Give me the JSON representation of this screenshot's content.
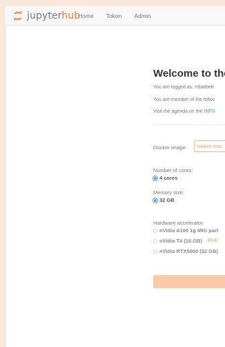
{
  "header": {
    "logo": {
      "prefix": "jupyter",
      "suffix": "hub",
      "icon": "jupyter-logo-icon"
    },
    "nav": [
      {
        "label": "Home"
      },
      {
        "label": "Token"
      },
      {
        "label": "Admin"
      }
    ]
  },
  "main": {
    "title": "Welcome to the",
    "logged_in_text": "You are logged as: mbarbett",
    "member_text": "You are member of the follov",
    "agenda_prefix": "Visit the agenda on the ",
    "agenda_link": "INFN",
    "docker": {
      "label": "Docker image:",
      "value": "harbor.clou"
    },
    "cores": {
      "label": "Number of cores:",
      "options": [
        {
          "label": "4 cores",
          "checked": true
        }
      ]
    },
    "memory": {
      "label": "Memory size:",
      "options": [
        {
          "label": "32 GB",
          "checked": true
        }
      ]
    },
    "accelerator": {
      "label": "Hardware accelerator:",
      "options": [
        {
          "label": "nVidia A100 1g MIG part",
          "checked": false,
          "badge": ""
        },
        {
          "label": "nVidia T4 (16 GB)",
          "checked": false,
          "badge": "1/1 av"
        },
        {
          "label": "nVidia RTX5000 (32 GB)",
          "checked": false,
          "badge": ""
        }
      ]
    }
  },
  "colors": {
    "accent": "#f37626",
    "link": "#4aa3df",
    "badge_green": "#6cc24a",
    "button": "#f9c9a9"
  }
}
